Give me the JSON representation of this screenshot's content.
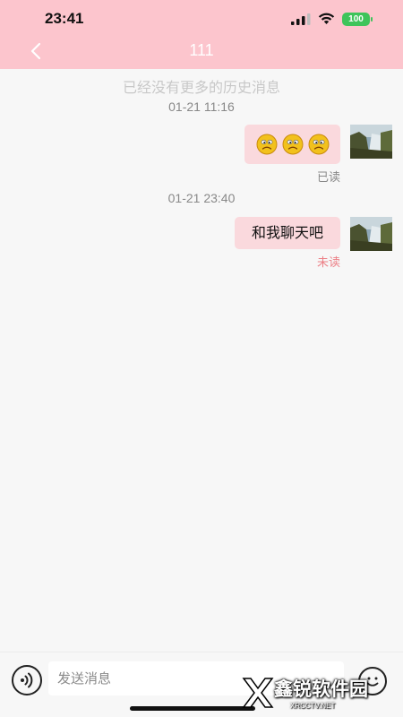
{
  "status_bar": {
    "time": "23:41",
    "battery": "100",
    "battery_color": "#3ec45a"
  },
  "header": {
    "title": "111",
    "background": "#fcc5cd",
    "back_icon": "chevron-left-icon"
  },
  "chat": {
    "history_note": "已经没有更多的历史消息",
    "messages": [
      {
        "timestamp": "01-21 11:16",
        "content": "emoji",
        "emoji_icons": [
          "confused-face-icon",
          "confused-face-icon",
          "confused-face-icon"
        ],
        "emoji_count": 3,
        "status": "已读",
        "status_color": "#888888"
      },
      {
        "timestamp": "01-21 23:40",
        "text": "和我聊天吧",
        "status": "未读",
        "status_color": "#ec7f86"
      }
    ],
    "bubble_color": "#fad9dd"
  },
  "input_bar": {
    "placeholder": "发送消息",
    "voice_icon": "voice-icon",
    "emoji_icon": "emoji-icon"
  },
  "watermark": {
    "text": "鑫锐软件园",
    "sub": "XRCCTV.NET"
  }
}
